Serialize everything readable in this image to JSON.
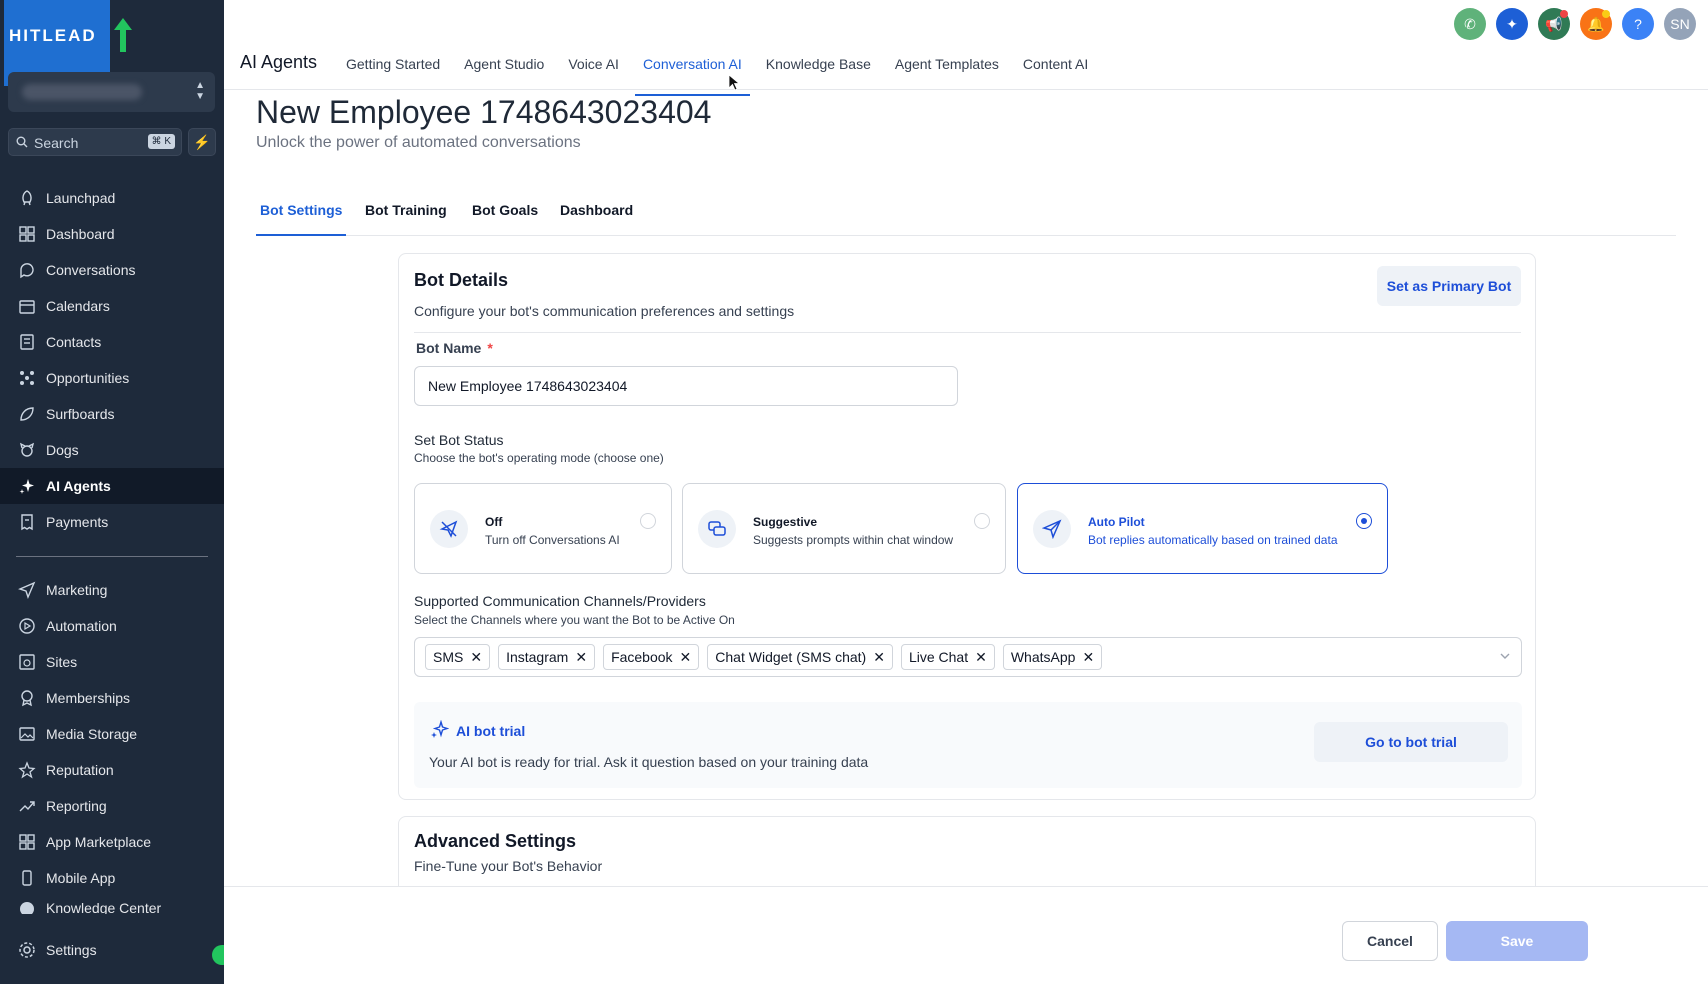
{
  "brand": {
    "logo_text": "HITLEAD"
  },
  "sidebar": {
    "search_label": "Search",
    "search_shortcut": "⌘ K",
    "items": [
      {
        "label": "Launchpad",
        "icon": "rocket-icon"
      },
      {
        "label": "Dashboard",
        "icon": "grid-icon"
      },
      {
        "label": "Conversations",
        "icon": "chat-icon"
      },
      {
        "label": "Calendars",
        "icon": "calendar-icon"
      },
      {
        "label": "Contacts",
        "icon": "contacts-icon"
      },
      {
        "label": "Opportunities",
        "icon": "network-icon"
      },
      {
        "label": "Surfboards",
        "icon": "surfboard-icon"
      },
      {
        "label": "Dogs",
        "icon": "dog-icon"
      },
      {
        "label": "AI Agents",
        "icon": "sparkle-icon"
      },
      {
        "label": "Payments",
        "icon": "receipt-icon"
      }
    ],
    "items2": [
      {
        "label": "Marketing",
        "icon": "send-icon"
      },
      {
        "label": "Automation",
        "icon": "automation-icon"
      },
      {
        "label": "Sites",
        "icon": "globe-icon"
      },
      {
        "label": "Memberships",
        "icon": "badge-icon"
      },
      {
        "label": "Media Storage",
        "icon": "image-icon"
      },
      {
        "label": "Reputation",
        "icon": "star-icon"
      },
      {
        "label": "Reporting",
        "icon": "trend-icon"
      },
      {
        "label": "App Marketplace",
        "icon": "apps-icon"
      },
      {
        "label": "Mobile App",
        "icon": "mobile-icon"
      },
      {
        "label": "Knowledge Center",
        "icon": "info-icon"
      }
    ],
    "settings_label": "Settings",
    "active_index": 8
  },
  "header": {
    "section_title": "AI Agents",
    "tabs": [
      {
        "label": "Getting Started"
      },
      {
        "label": "Agent Studio"
      },
      {
        "label": "Voice AI"
      },
      {
        "label": "Conversation AI"
      },
      {
        "label": "Knowledge Base"
      },
      {
        "label": "Agent Templates"
      },
      {
        "label": "Content AI"
      }
    ],
    "active_tab": "Conversation AI",
    "avatar_initials": "SN",
    "colors": {
      "phone": "#5fb27a",
      "sparkle": "#1d5fd6",
      "megaphone": "#2f7a55",
      "bell": "#f97316",
      "help": "#3b82f6",
      "avatar": "#94a3b8"
    }
  },
  "page": {
    "title": "New Employee 1748643023404",
    "subtitle": "Unlock the power of automated conversations",
    "tabs": [
      {
        "label": "Bot Settings"
      },
      {
        "label": "Bot Training"
      },
      {
        "label": "Bot Goals"
      },
      {
        "label": "Dashboard"
      }
    ],
    "active_tab": "Bot Settings"
  },
  "bot_details": {
    "title": "Bot Details",
    "description": "Configure your bot's communication preferences and settings",
    "primary_button": "Set as Primary Bot",
    "bot_name_label": "Bot Name",
    "required_mark": "*",
    "bot_name_value": "New Employee 1748643023404",
    "status_title": "Set Bot Status",
    "status_sub": "Choose the bot's operating mode (choose one)",
    "status_options": [
      {
        "title": "Off",
        "desc": "Turn off Conversations AI",
        "icon": "paper-plane-off-icon",
        "selected": false
      },
      {
        "title": "Suggestive",
        "desc": "Suggests prompts within chat window",
        "icon": "chat-bubbles-icon",
        "selected": false
      },
      {
        "title": "Auto Pilot",
        "desc": "Bot replies automatically based on trained data",
        "icon": "paper-plane-icon",
        "selected": true
      }
    ],
    "channels_title": "Supported Communication Channels/Providers",
    "channels_sub": "Select the Channels where you want the Bot to be Active On",
    "channels": [
      "SMS",
      "Instagram",
      "Facebook",
      "Chat Widget (SMS chat)",
      "Live Chat",
      "WhatsApp"
    ],
    "trial_title": "AI bot trial",
    "trial_desc": "Your AI bot is ready for trial. Ask it question based on your training data",
    "trial_button": "Go to bot trial"
  },
  "advanced": {
    "title": "Advanced Settings",
    "description": "Fine-Tune your Bot's Behavior"
  },
  "footer": {
    "cancel": "Cancel",
    "save": "Save"
  },
  "accent_color": "#1d4ed8"
}
